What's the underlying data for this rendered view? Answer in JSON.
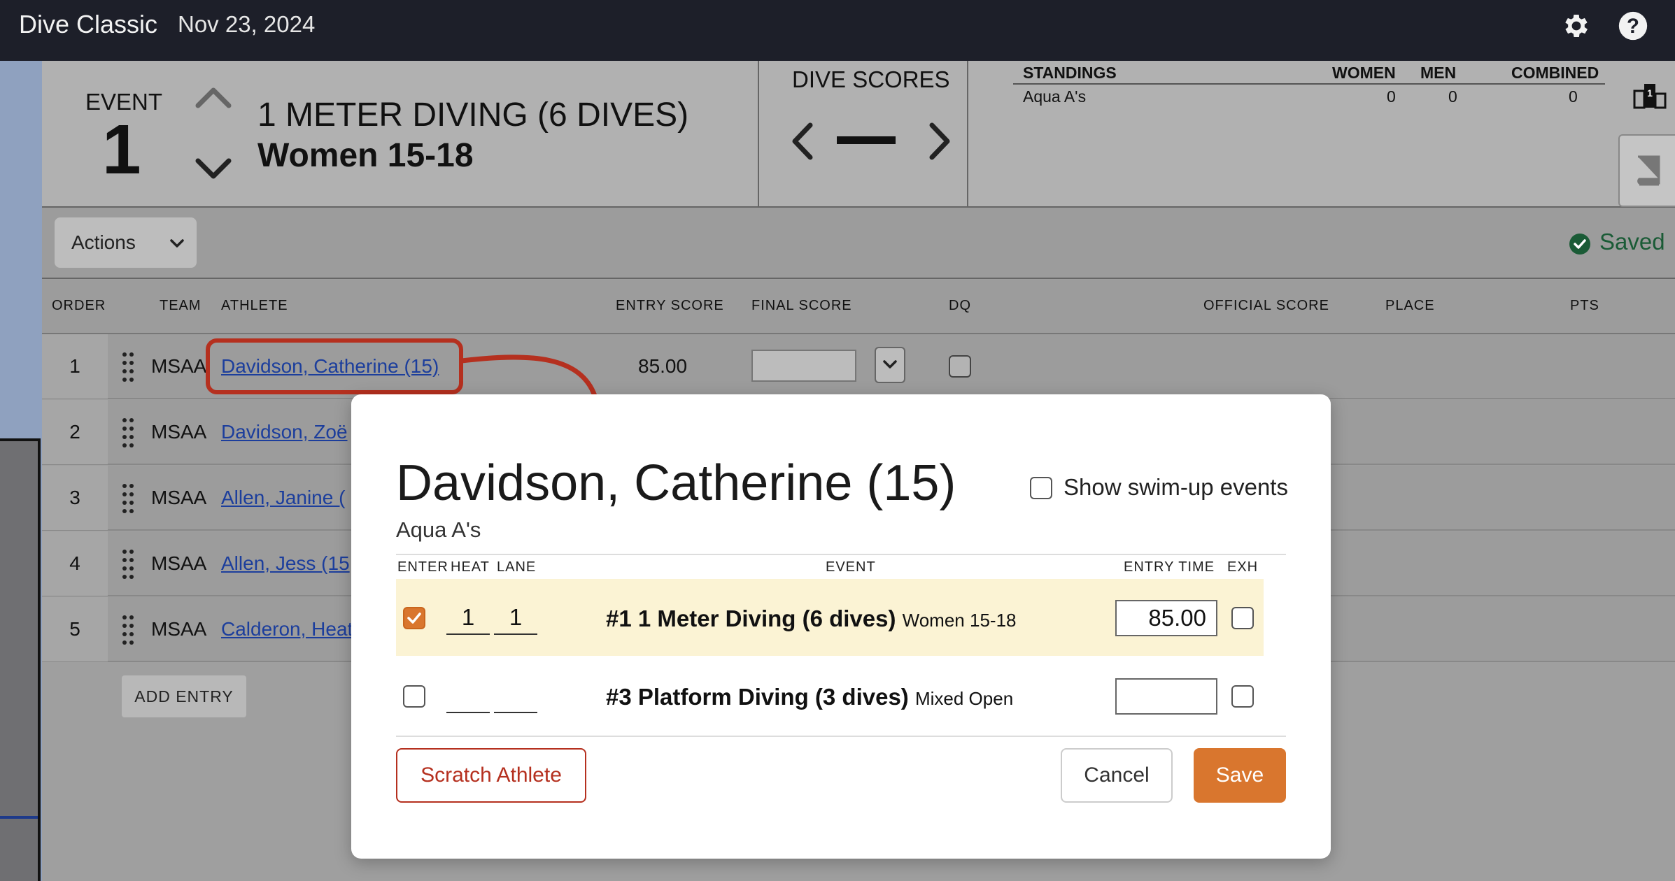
{
  "topbar": {
    "title": "Dive Classic",
    "date": "Nov 23, 2024",
    "settings_icon": "gear-icon",
    "help_icon": "help-icon"
  },
  "header": {
    "event_label": "EVENT",
    "event_number": "1",
    "event_name": "1 METER DIVING (6 DIVES)",
    "event_group": "Women 15-18",
    "dive_scores_title": "DIVE SCORES",
    "standings": {
      "title": "STANDINGS",
      "columns": [
        "WOMEN",
        "MEN",
        "COMBINED"
      ],
      "rows": [
        {
          "team": "Aqua A's",
          "women": "0",
          "men": "0",
          "combined": "0"
        }
      ]
    }
  },
  "toolbar": {
    "actions_label": "Actions",
    "status": "Saved"
  },
  "table": {
    "columns": {
      "order": "ORDER",
      "team": "TEAM",
      "athlete": "ATHLETE",
      "entry_score": "ENTRY SCORE",
      "final_score": "FINAL SCORE",
      "dq": "DQ",
      "official_score": "OFFICIAL SCORE",
      "place": "PLACE",
      "pts": "PTS"
    },
    "rows": [
      {
        "order": "1",
        "team": "MSAA",
        "athlete": "Davidson, Catherine (15)",
        "entry_score": "85.00"
      },
      {
        "order": "2",
        "team": "MSAA",
        "athlete": "Davidson, Zoë"
      },
      {
        "order": "3",
        "team": "MSAA",
        "athlete": "Allen, Janine ("
      },
      {
        "order": "4",
        "team": "MSAA",
        "athlete": "Allen, Jess (15"
      },
      {
        "order": "5",
        "team": "MSAA",
        "athlete": "Calderon, Heat"
      }
    ],
    "add_entry_label": "ADD ENTRY"
  },
  "modal": {
    "athlete_name": "Davidson, Catherine (15)",
    "team": "Aqua A's",
    "show_swim_up_label": "Show swim-up events",
    "columns": {
      "enter": "ENTER",
      "heat": "HEAT",
      "lane": "LANE",
      "event": "EVENT",
      "entry_time": "ENTRY TIME",
      "exh": "EXH"
    },
    "events": [
      {
        "checked": true,
        "heat": "1",
        "lane": "1",
        "event": "#1 1 Meter Diving (6 dives)",
        "group": "Women 15-18",
        "entry_time": "85.00"
      },
      {
        "checked": false,
        "heat": "",
        "lane": "",
        "event": "#3 Platform Diving (3 dives)",
        "group": "Mixed Open",
        "entry_time": ""
      }
    ],
    "scratch_label": "Scratch Athlete",
    "cancel_label": "Cancel",
    "save_label": "Save"
  },
  "colors": {
    "accent": "#d9762e",
    "danger": "#b5301f",
    "link": "#1c3e9c",
    "saved": "#1a5b36",
    "topbar": "#1d1f29"
  }
}
